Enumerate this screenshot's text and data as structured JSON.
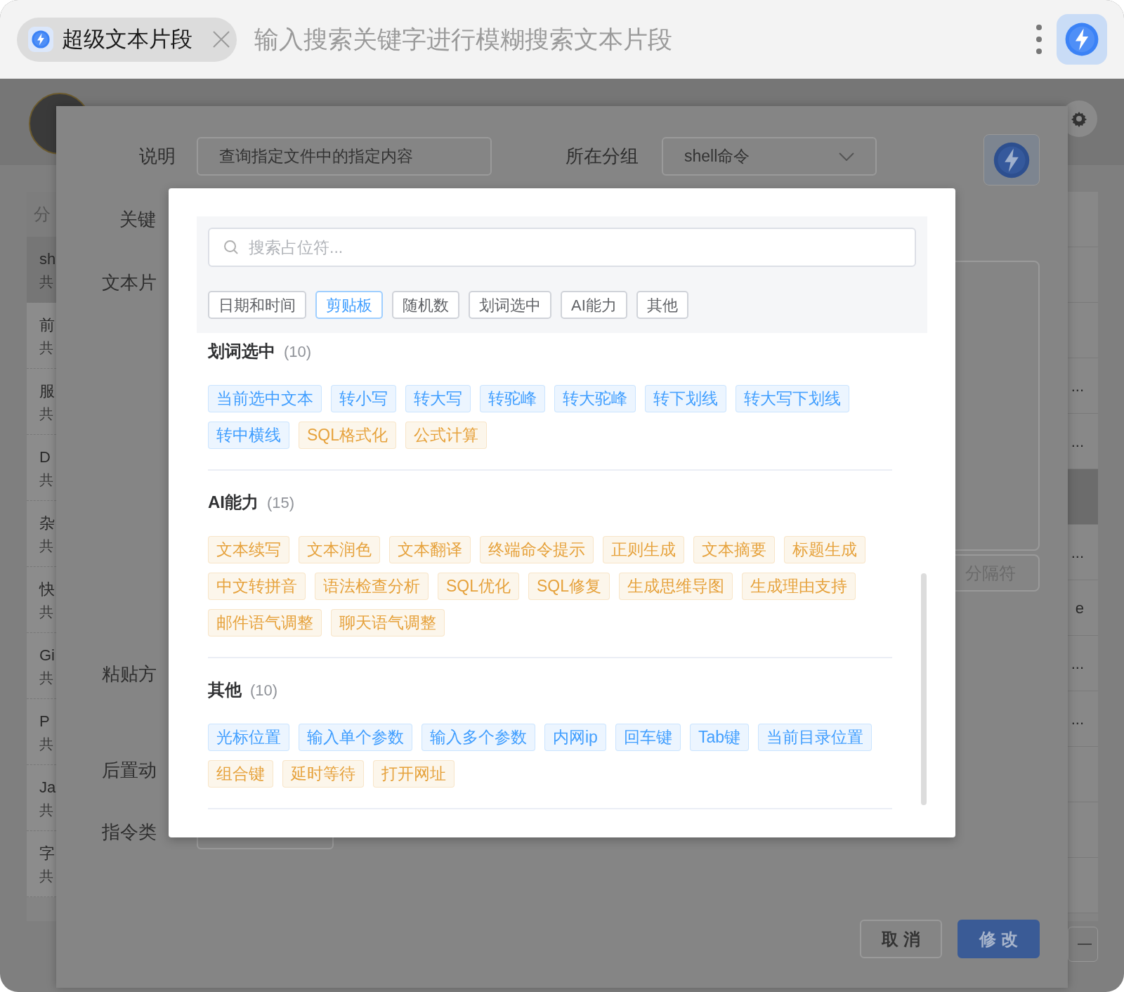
{
  "app_bar": {
    "tab_title": "超级文本片段",
    "search_placeholder": "输入搜索关键字进行模糊搜索文本片段"
  },
  "page": {
    "sidebar_header": "分",
    "sidebar_items": [
      {
        "title": "sh",
        "sub": "共",
        "selected": true
      },
      {
        "title": "前",
        "sub": "共",
        "selected": false
      },
      {
        "title": "服",
        "sub": "共",
        "selected": false
      },
      {
        "title": "D",
        "sub": "共",
        "selected": false
      },
      {
        "title": "杂",
        "sub": "共",
        "selected": false
      },
      {
        "title": "快",
        "sub": "共",
        "selected": false
      },
      {
        "title": "Gi",
        "sub": "共",
        "selected": false
      },
      {
        "title": "P",
        "sub": "共",
        "selected": false
      },
      {
        "title": "Ja",
        "sub": "共",
        "selected": false
      },
      {
        "title": "字",
        "sub": "共",
        "selected": false
      }
    ],
    "right_rows": [
      {
        "selected": false
      },
      {
        "selected": false
      },
      {
        "selected": false
      },
      {
        "text": "...",
        "selected": false
      },
      {
        "text": "...",
        "selected": false
      },
      {
        "selected": true
      },
      {
        "text": "...",
        "selected": false
      },
      {
        "text": "e",
        "selected": false
      },
      {
        "text": "...",
        "selected": false
      },
      {
        "text": "...",
        "selected": false
      },
      {
        "selected": false
      },
      {
        "selected": false
      },
      {
        "selected": false
      }
    ]
  },
  "edit_dialog": {
    "description_label": "说明",
    "description_value": "查询指定文件中的指定内容",
    "group_label": "所在分组",
    "group_value": "shell命令",
    "keyword_label": "关键",
    "snippet_label": "文本片",
    "separator_placeholder": "分隔符",
    "paste_label": "粘贴方",
    "post_action_label": "后置动",
    "command_type_label": "指令类",
    "buttons": [
      {
        "label": "取消",
        "kind": "secondary"
      },
      {
        "label": "修改",
        "kind": "primary"
      }
    ]
  },
  "placeholder_picker": {
    "search_placeholder": "搜索占位符...",
    "categories": [
      {
        "label": "日期和时间",
        "selected": false
      },
      {
        "label": "剪贴板",
        "selected": true
      },
      {
        "label": "随机数",
        "selected": false
      },
      {
        "label": "划词选中",
        "selected": false
      },
      {
        "label": "AI能力",
        "selected": false
      },
      {
        "label": "其他",
        "selected": false
      }
    ],
    "sections": [
      {
        "title": "划词选中",
        "count": "(10)",
        "items": [
          {
            "label": "当前选中文本",
            "color": "#409eff"
          },
          {
            "label": "转小写",
            "color": "#409eff"
          },
          {
            "label": "转大写",
            "color": "#409eff"
          },
          {
            "label": "转驼峰",
            "color": "#409eff"
          },
          {
            "label": "转大驼峰",
            "color": "#409eff"
          },
          {
            "label": "转下划线",
            "color": "#409eff"
          },
          {
            "label": "转大写下划线",
            "color": "#409eff"
          },
          {
            "label": "转中横线",
            "color": "#409eff"
          },
          {
            "label": "SQL格式化",
            "color": "#e6a23c"
          },
          {
            "label": "公式计算",
            "color": "#e6a23c"
          }
        ]
      },
      {
        "title": "AI能力",
        "count": "(15)",
        "items": [
          {
            "label": "文本续写",
            "color": "#e6a23c"
          },
          {
            "label": "文本润色",
            "color": "#e6a23c"
          },
          {
            "label": "文本翻译",
            "color": "#e6a23c"
          },
          {
            "label": "终端命令提示",
            "color": "#e6a23c"
          },
          {
            "label": "正则生成",
            "color": "#e6a23c"
          },
          {
            "label": "文本摘要",
            "color": "#e6a23c"
          },
          {
            "label": "标题生成",
            "color": "#e6a23c"
          },
          {
            "label": "中文转拼音",
            "color": "#e6a23c"
          },
          {
            "label": "语法检查分析",
            "color": "#e6a23c"
          },
          {
            "label": "SQL优化",
            "color": "#e6a23c"
          },
          {
            "label": "SQL修复",
            "color": "#e6a23c"
          },
          {
            "label": "生成思维导图",
            "color": "#e6a23c"
          },
          {
            "label": "生成理由支持",
            "color": "#e6a23c"
          },
          {
            "label": "邮件语气调整",
            "color": "#e6a23c"
          },
          {
            "label": "聊天语气调整",
            "color": "#e6a23c"
          }
        ]
      },
      {
        "title": "其他",
        "count": "(10)",
        "items": [
          {
            "label": "光标位置",
            "color": "#409eff"
          },
          {
            "label": "输入单个参数",
            "color": "#409eff"
          },
          {
            "label": "输入多个参数",
            "color": "#409eff"
          },
          {
            "label": "内网ip",
            "color": "#409eff"
          },
          {
            "label": "回车键",
            "color": "#409eff"
          },
          {
            "label": "Tab键",
            "color": "#409eff"
          },
          {
            "label": "当前目录位置",
            "color": "#409eff"
          },
          {
            "label": "组合键",
            "color": "#e6a23c"
          },
          {
            "label": "延时等待",
            "color": "#e6a23c"
          },
          {
            "label": "打开网址",
            "color": "#e6a23c"
          }
        ]
      }
    ]
  }
}
